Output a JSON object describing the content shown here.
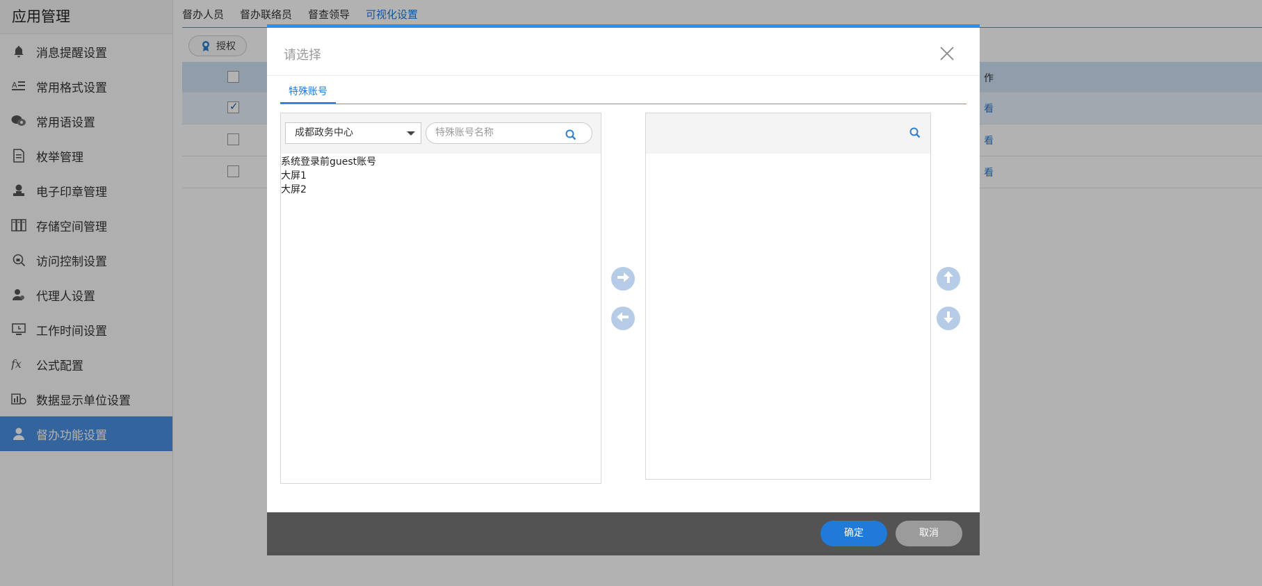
{
  "sidebar": {
    "title": "应用管理",
    "items": [
      {
        "label": "消息提醒设置",
        "icon": "bell-icon"
      },
      {
        "label": "常用格式设置",
        "icon": "text-format-icon"
      },
      {
        "label": "常用语设置",
        "icon": "chat-bubbles-icon"
      },
      {
        "label": "枚举管理",
        "icon": "document-list-icon"
      },
      {
        "label": "电子印章管理",
        "icon": "stamp-icon"
      },
      {
        "label": "存储空间管理",
        "icon": "storage-icon"
      },
      {
        "label": "访问控制设置",
        "icon": "access-control-icon"
      },
      {
        "label": "代理人设置",
        "icon": "agent-user-icon"
      },
      {
        "label": "工作时间设置",
        "icon": "monitor-clock-icon"
      },
      {
        "label": "公式配置",
        "icon": "fx-formula-icon"
      },
      {
        "label": "数据显示单位设置",
        "icon": "data-unit-icon"
      },
      {
        "label": "督办功能设置",
        "icon": "supervise-user-icon",
        "active": true
      }
    ]
  },
  "top_tabs": [
    {
      "label": "督办人员"
    },
    {
      "label": "督办联络员"
    },
    {
      "label": "督查领导"
    },
    {
      "label": "可视化设置",
      "active": true
    }
  ],
  "toolbar": {
    "grant_label": "授权"
  },
  "table": {
    "header_tail": "作",
    "rows": [
      {
        "checked": true,
        "link": "看"
      },
      {
        "checked": false,
        "link": "看"
      },
      {
        "checked": false,
        "link": "看"
      }
    ]
  },
  "modal": {
    "title": "请选择",
    "tab": "特殊账号",
    "org_select": "成都政务中心",
    "search_placeholder": "特殊账号名称",
    "accounts": [
      "系统登录前guest账号",
      "大屏1",
      "大屏2"
    ],
    "ok_label": "确定",
    "cancel_label": "取消"
  },
  "colors": {
    "accent": "#1f7ad8",
    "modal_top_bar": "#2f8eea",
    "footer": "#535353",
    "cancel": "#9b9b9b",
    "sidebar_active": "#4a90e2"
  }
}
